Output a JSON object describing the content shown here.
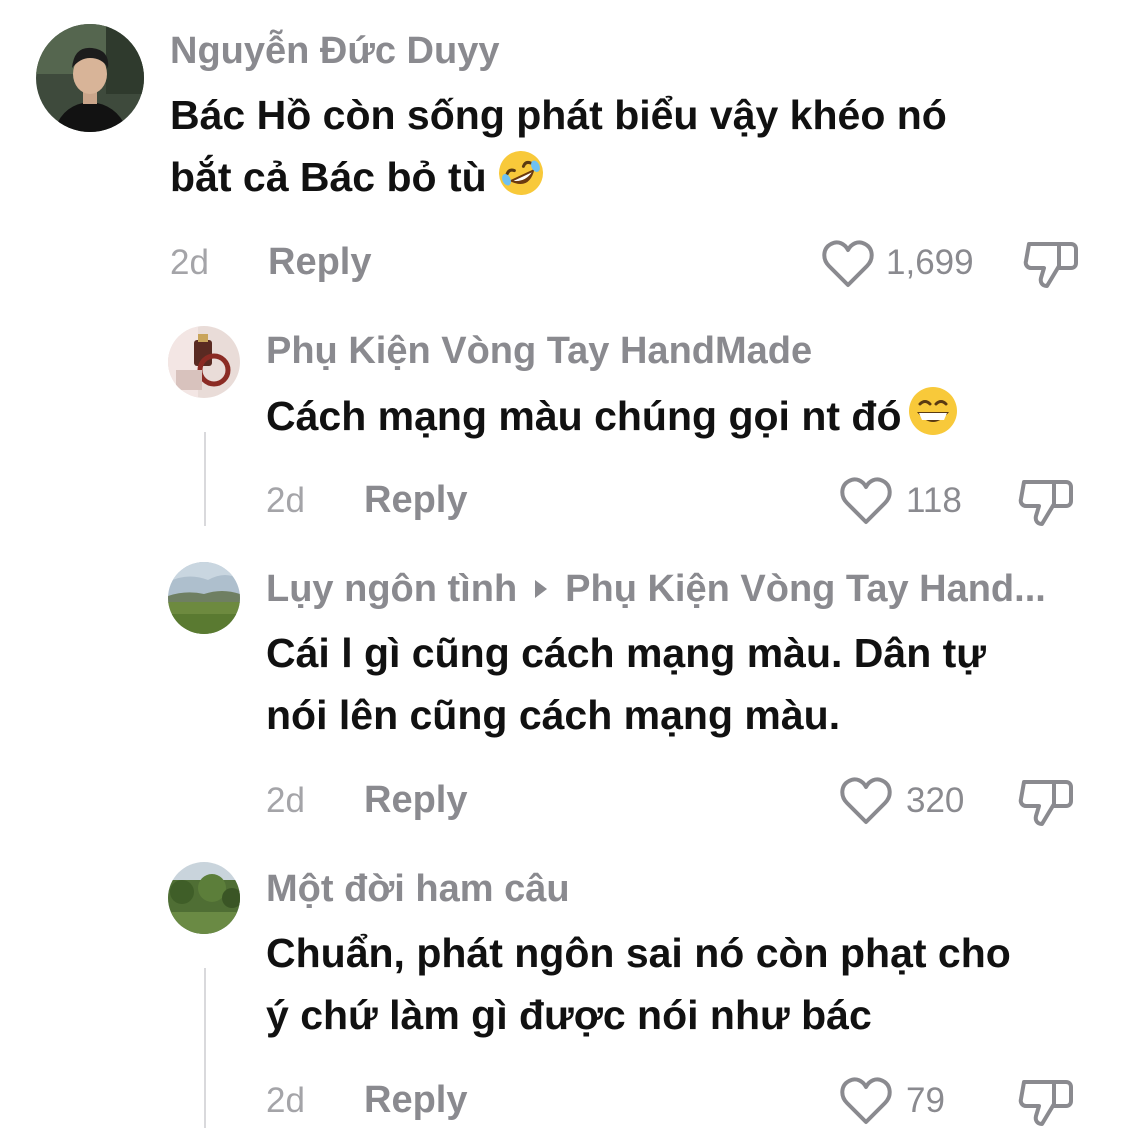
{
  "comments": [
    {
      "username": "Nguyễn Đức Duyy",
      "lines": [
        "Bác Hồ còn sống phát biểu vậy khéo nó",
        "bắt cả Bác bỏ tù"
      ],
      "emoji": "rolling-on-floor-laughing",
      "time": "2d",
      "reply_label": "Reply",
      "likes": "1,699"
    },
    {
      "username": "Phụ Kiện Vòng Tay HandMade",
      "lines": [
        "Cách mạng màu chúng gọi nt đó"
      ],
      "emoji": "grinning-face",
      "time": "2d",
      "reply_label": "Reply",
      "likes": "118"
    },
    {
      "username": "Lụy ngôn tình",
      "reply_to": "Phụ Kiện Vòng Tay Hand...",
      "lines": [
        "Cái l gì cũng cách mạng màu. Dân tự",
        "nói lên cũng cách mạng màu."
      ],
      "time": "2d",
      "reply_label": "Reply",
      "likes": "320"
    },
    {
      "username": "Một đời ham câu",
      "lines": [
        "Chuẩn, phát ngôn sai nó còn phạt cho",
        "ý chứ làm gì được nói như bác"
      ],
      "time": "2d",
      "reply_label": "Reply",
      "likes": "79"
    }
  ],
  "icons": {
    "like": "heart-outline-icon",
    "dislike": "thumbs-down-outline-icon"
  },
  "colors": {
    "username": "#8a8a8f",
    "text": "#111111",
    "meta": "#a4a4a8",
    "icon": "#8a8a8f"
  }
}
